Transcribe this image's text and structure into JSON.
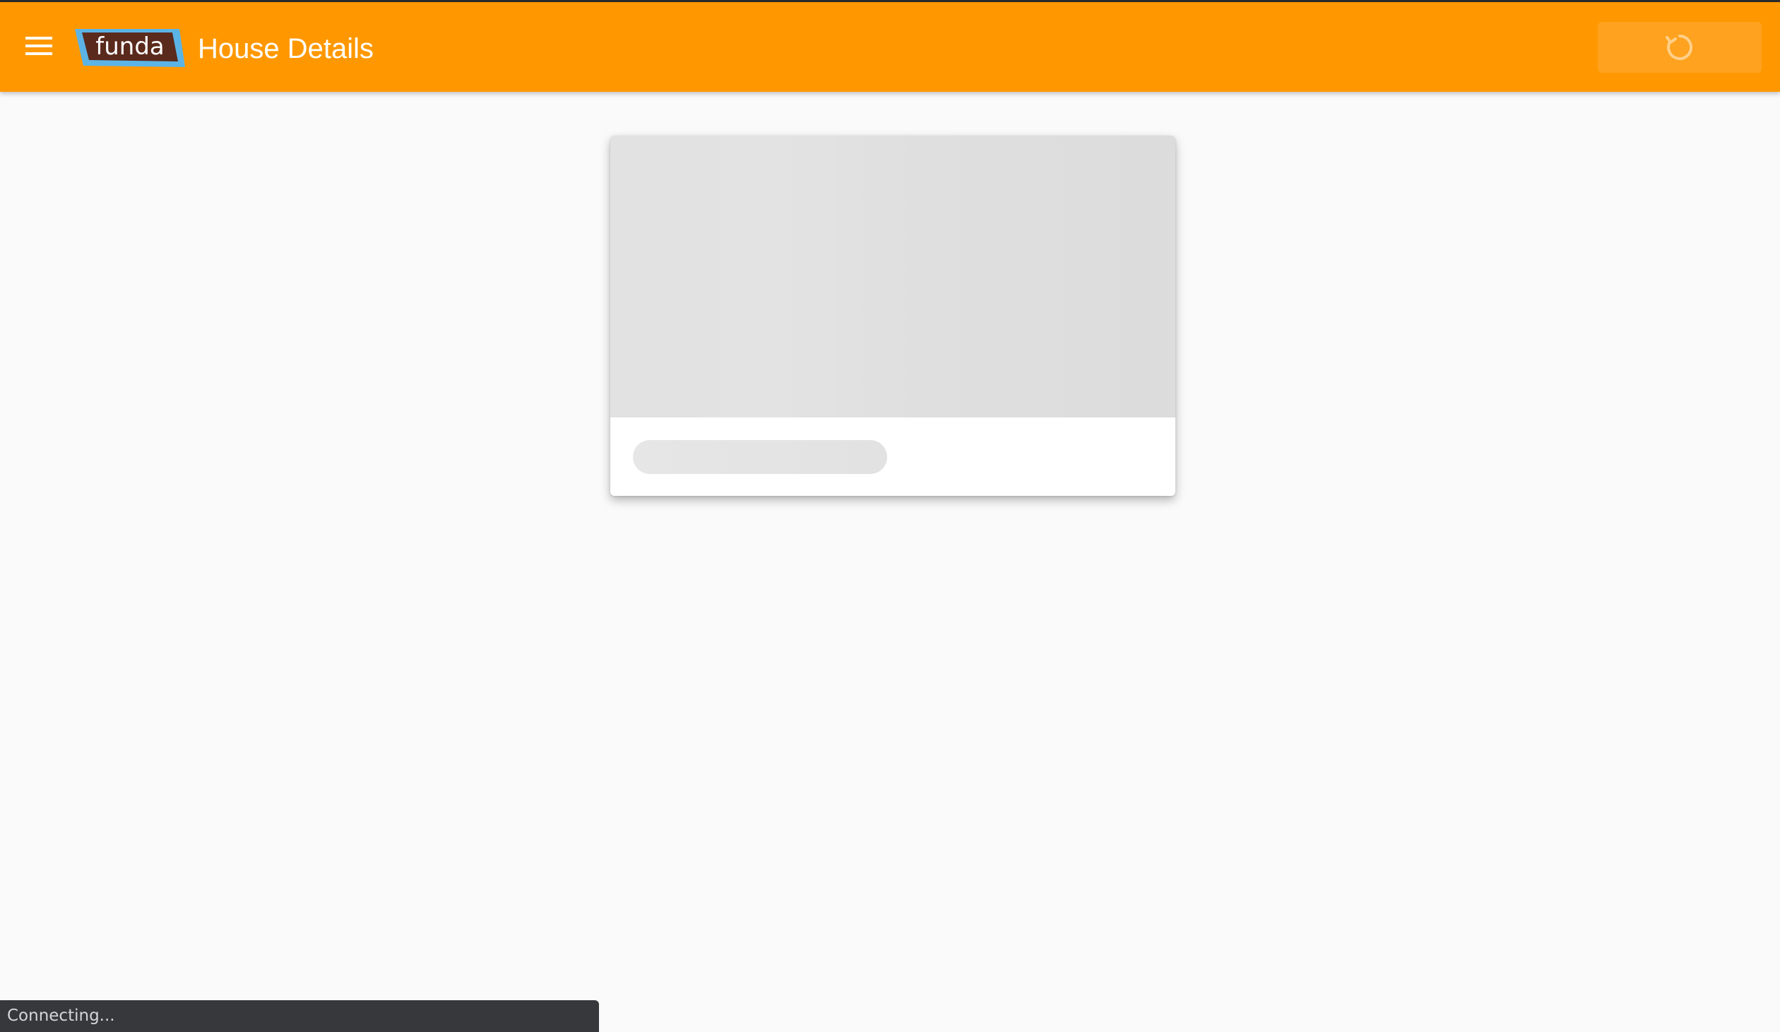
{
  "header": {
    "logo_text": "funda",
    "title": "House Details",
    "menu_icon": "hamburger-menu-icon",
    "refresh_icon": "refresh-icon",
    "refresh_state": "loading"
  },
  "content": {
    "card_state": "loading-skeleton"
  },
  "status_bar": {
    "text": "Connecting..."
  },
  "colors": {
    "appbar": "#ff9800",
    "refresh_button": "#ffa21f",
    "background": "#fafafa",
    "logo_brown": "#5a2a1c",
    "logo_blue": "#5bb4e5",
    "status_bar": "#36383c"
  }
}
